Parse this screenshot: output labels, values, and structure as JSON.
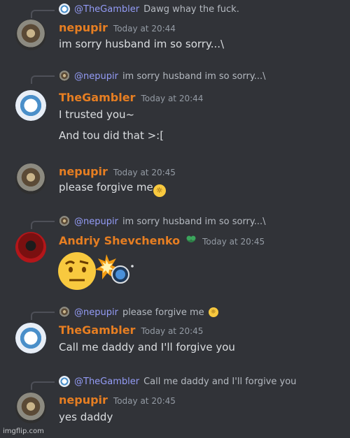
{
  "messages": [
    {
      "reply": {
        "user": "@TheGambler",
        "text": "Dawg whay the fuck."
      },
      "author": "nepupir",
      "time": "Today at 20:44",
      "lines": [
        "im sorry husband im so sorry...\\"
      ]
    },
    {
      "reply": {
        "user": "@nepupir",
        "text": "im sorry husband im so sorry...\\"
      },
      "author": "TheGambler",
      "time": "Today at 20:44",
      "lines": [
        "I trusted you~",
        "And tou did that >:["
      ]
    },
    {
      "author": "nepupir",
      "time": "Today at 20:45",
      "lines": [
        "please forgive me"
      ]
    },
    {
      "reply": {
        "user": "@nepupir",
        "text": "im sorry husband im so sorry...\\"
      },
      "author": "Andriy Shevchenko",
      "time": "Today at 20:45"
    },
    {
      "reply": {
        "user": "@nepupir",
        "text": "please forgive me"
      },
      "author": "TheGambler",
      "time": "Today at 20:45",
      "lines": [
        "Call me daddy and I'll forgive you"
      ]
    },
    {
      "reply": {
        "user": "@TheGambler",
        "text": "Call me daddy and I'll forgive you"
      },
      "author": "nepupir",
      "time": "Today at 20:45",
      "lines": [
        "yes daddy"
      ]
    }
  ],
  "watermark": "imgflip.com",
  "colors": {
    "background": "#313338",
    "username": "#e67e22",
    "reply_user": "#949cf7",
    "timestamp": "#949ba4"
  }
}
